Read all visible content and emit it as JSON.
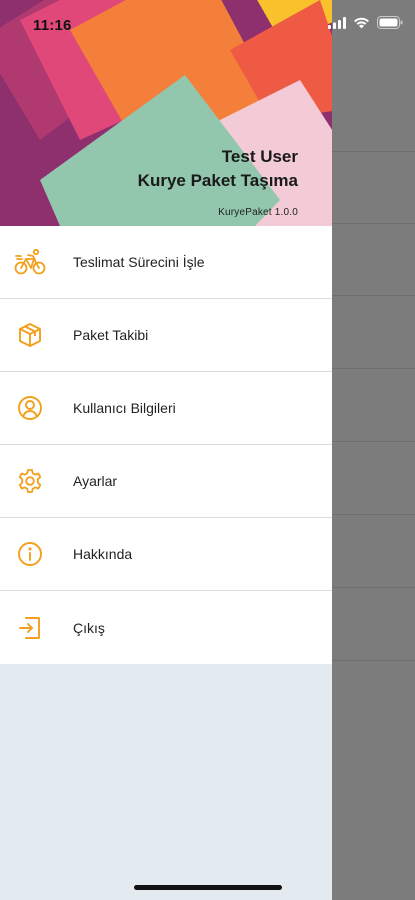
{
  "status_bar": {
    "time": "11:16",
    "icons": [
      "signal-icon",
      "wifi-icon",
      "battery-icon"
    ]
  },
  "header": {
    "name": "Test User",
    "subtitle": "Kurye Paket Taşıma",
    "version": "KuryePaket 1.0.0"
  },
  "menu": {
    "accent_color": "#f2a01c",
    "items": [
      {
        "label": "Teslimat Sürecini İşle",
        "icon": "bicycle-icon"
      },
      {
        "label": "Paket Takibi",
        "icon": "package-icon"
      },
      {
        "label": "Kullanıcı Bilgileri",
        "icon": "user-circle-icon"
      },
      {
        "label": "Ayarlar",
        "icon": "gear-icon"
      },
      {
        "label": "Hakkında",
        "icon": "info-icon"
      },
      {
        "label": "Çıkış",
        "icon": "logout-icon"
      }
    ]
  }
}
